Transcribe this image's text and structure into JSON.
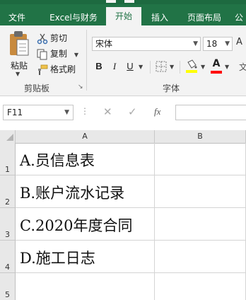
{
  "ribbon_tabs": [
    {
      "label": "文件",
      "active": false
    },
    {
      "label": "Excel与财务",
      "active": false
    },
    {
      "label": "开始",
      "active": true
    },
    {
      "label": "插入",
      "active": false
    },
    {
      "label": "页面布局",
      "active": false
    },
    {
      "label": "公",
      "active": false
    }
  ],
  "clipboard": {
    "paste_label": "粘贴",
    "cut_label": "剪切",
    "copy_label": "复制",
    "format_painter_label": "格式刷",
    "group_label": "剪贴板"
  },
  "font": {
    "font_name": "宋体",
    "font_size": "18",
    "bold_label": "B",
    "italic_label": "I",
    "underline_label": "U",
    "group_label": "字体"
  },
  "formula_bar": {
    "name_box": "F11",
    "fx_label": "fx"
  },
  "grid": {
    "columns": [
      "A",
      "B"
    ],
    "rows": [
      {
        "num": "1",
        "a": "A.员信息表"
      },
      {
        "num": "2",
        "a": "B.账户流水记录"
      },
      {
        "num": "3",
        "a": "C.2020年度合同"
      },
      {
        "num": "4",
        "a": "D.施工日志"
      },
      {
        "num": "5",
        "a": ""
      }
    ]
  },
  "colors": {
    "accent": "#217346",
    "highlight": "#ffff00",
    "font_color": "#ff0000"
  }
}
